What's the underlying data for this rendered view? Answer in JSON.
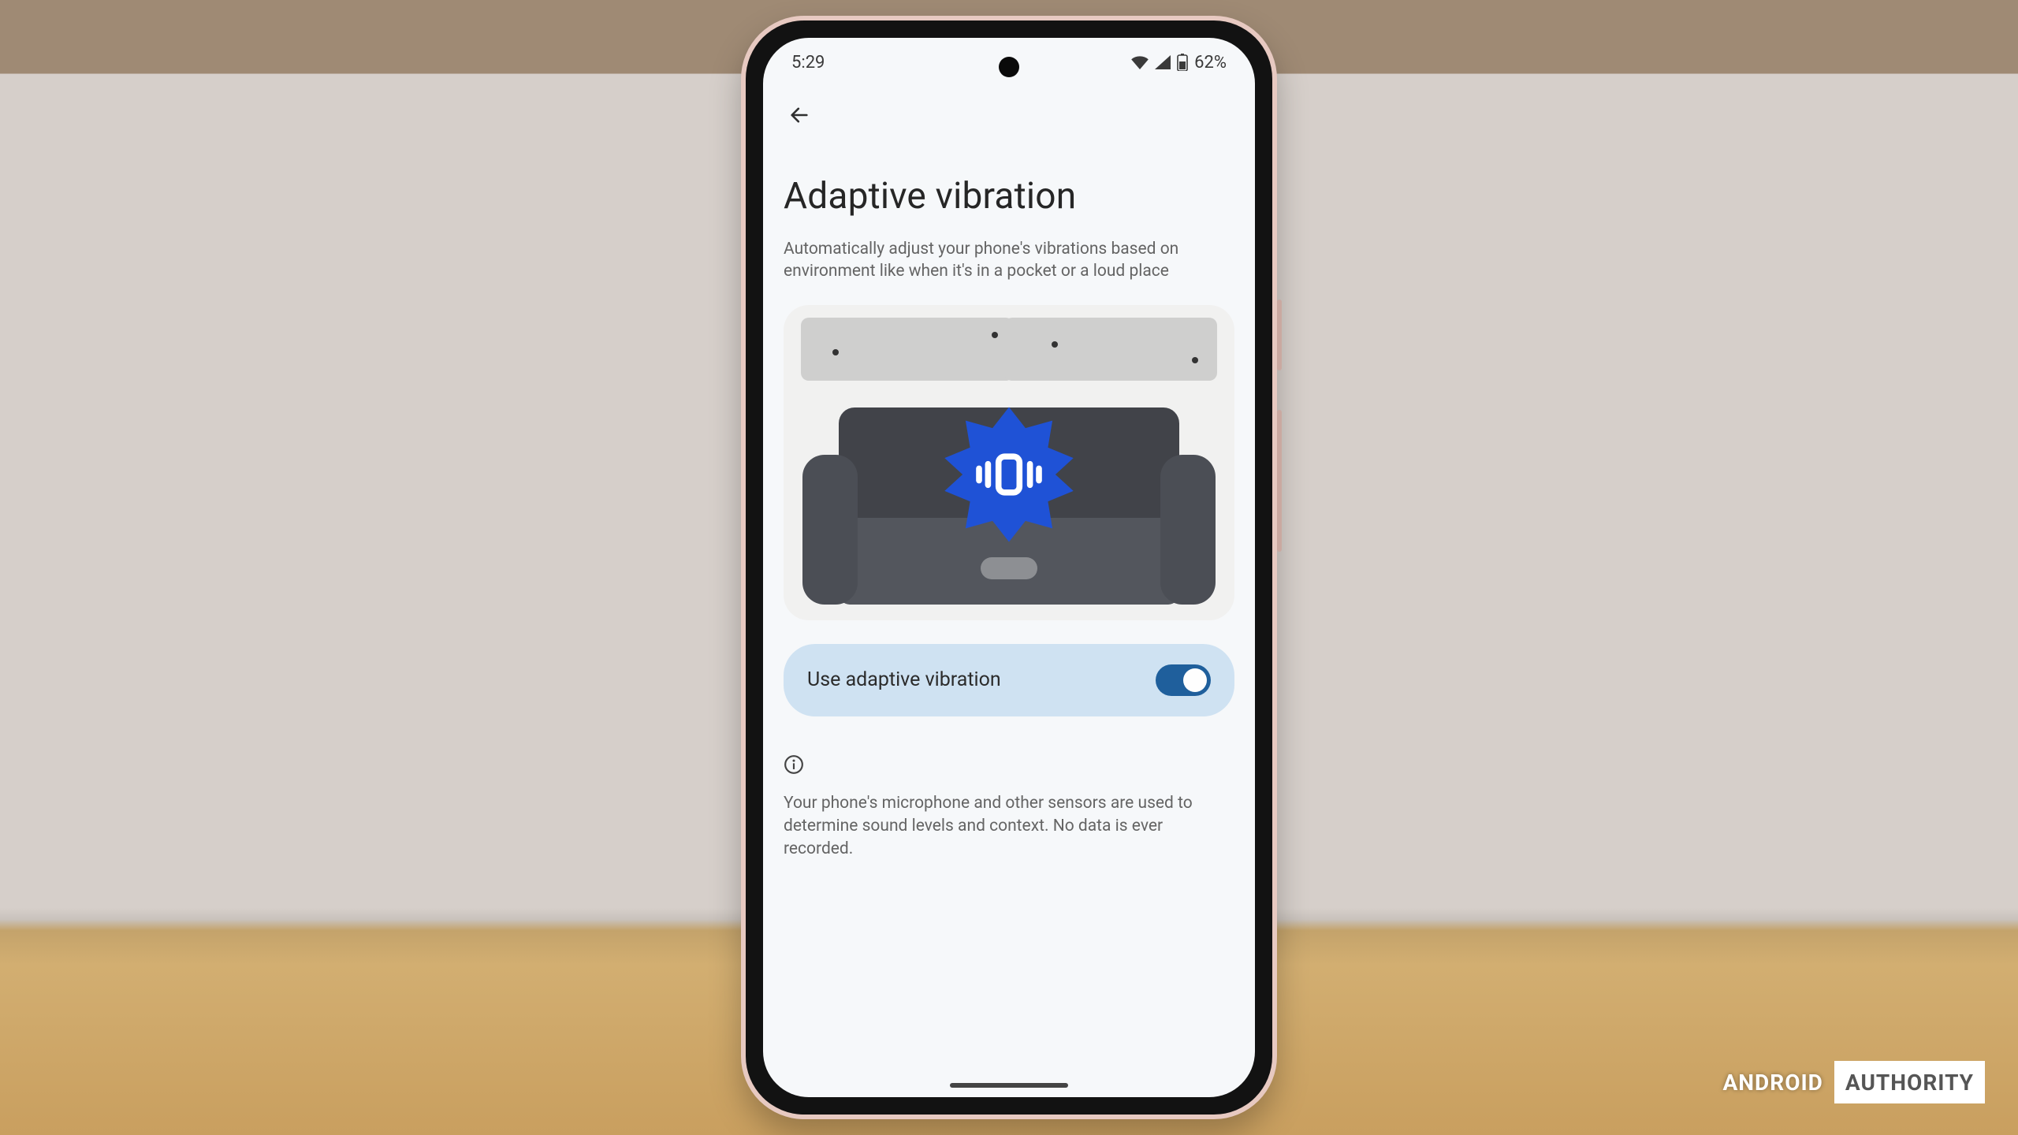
{
  "statusbar": {
    "time": "5:29",
    "battery_text": "62%"
  },
  "page": {
    "title": "Adaptive vibration",
    "description": "Automatically adjust your phone's vibrations based on environment like when it's in a pocket or a loud place"
  },
  "toggle": {
    "label": "Use adaptive vibration",
    "enabled": true
  },
  "info": {
    "text": "Your phone's microphone and other sensors are used to determine sound levels and context. No data is ever recorded."
  },
  "watermark": {
    "left": "ANDROID",
    "right": "AUTHORITY"
  }
}
